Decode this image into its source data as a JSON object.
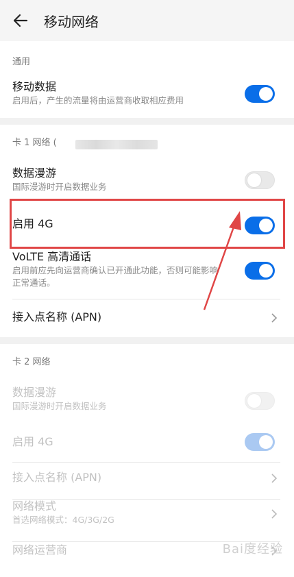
{
  "header": {
    "title": "移动网络",
    "back_icon": "arrow-left-icon"
  },
  "general": {
    "section_label": "通用",
    "mobile_data": {
      "title": "移动数据",
      "subtitle": "启用后，产生的流量将由运营商收取相应费用",
      "enabled": true
    }
  },
  "sim1": {
    "section_label": "卡 1 网络 (",
    "data_roaming": {
      "title": "数据漫游",
      "subtitle": "国际漫游时开启数据业务",
      "enabled": false
    },
    "enable_4g": {
      "title": "启用 4G",
      "enabled": true
    },
    "volte": {
      "title": "VoLTE 高清通话",
      "subtitle": "启用前应先向运营商确认已开通此功能，否则可能影响正常通话。",
      "enabled": true
    },
    "apn": {
      "title": "接入点名称 (APN)"
    }
  },
  "sim2": {
    "section_label": "卡 2 网络",
    "data_roaming": {
      "title": "数据漫游",
      "subtitle": "国际漫游时开启数据业务",
      "enabled": false
    },
    "enable_4g": {
      "title": "启用 4G",
      "enabled": true
    },
    "apn": {
      "title": "接入点名称 (APN)"
    },
    "network_mode": {
      "title": "网络模式",
      "subtitle": "首选网络模式：4G/3G/2G"
    },
    "operator": {
      "title": "网络运营商"
    }
  },
  "colors": {
    "accent": "#0a6ee8",
    "annotation": "#e04646"
  },
  "watermark": "Bai度经验"
}
